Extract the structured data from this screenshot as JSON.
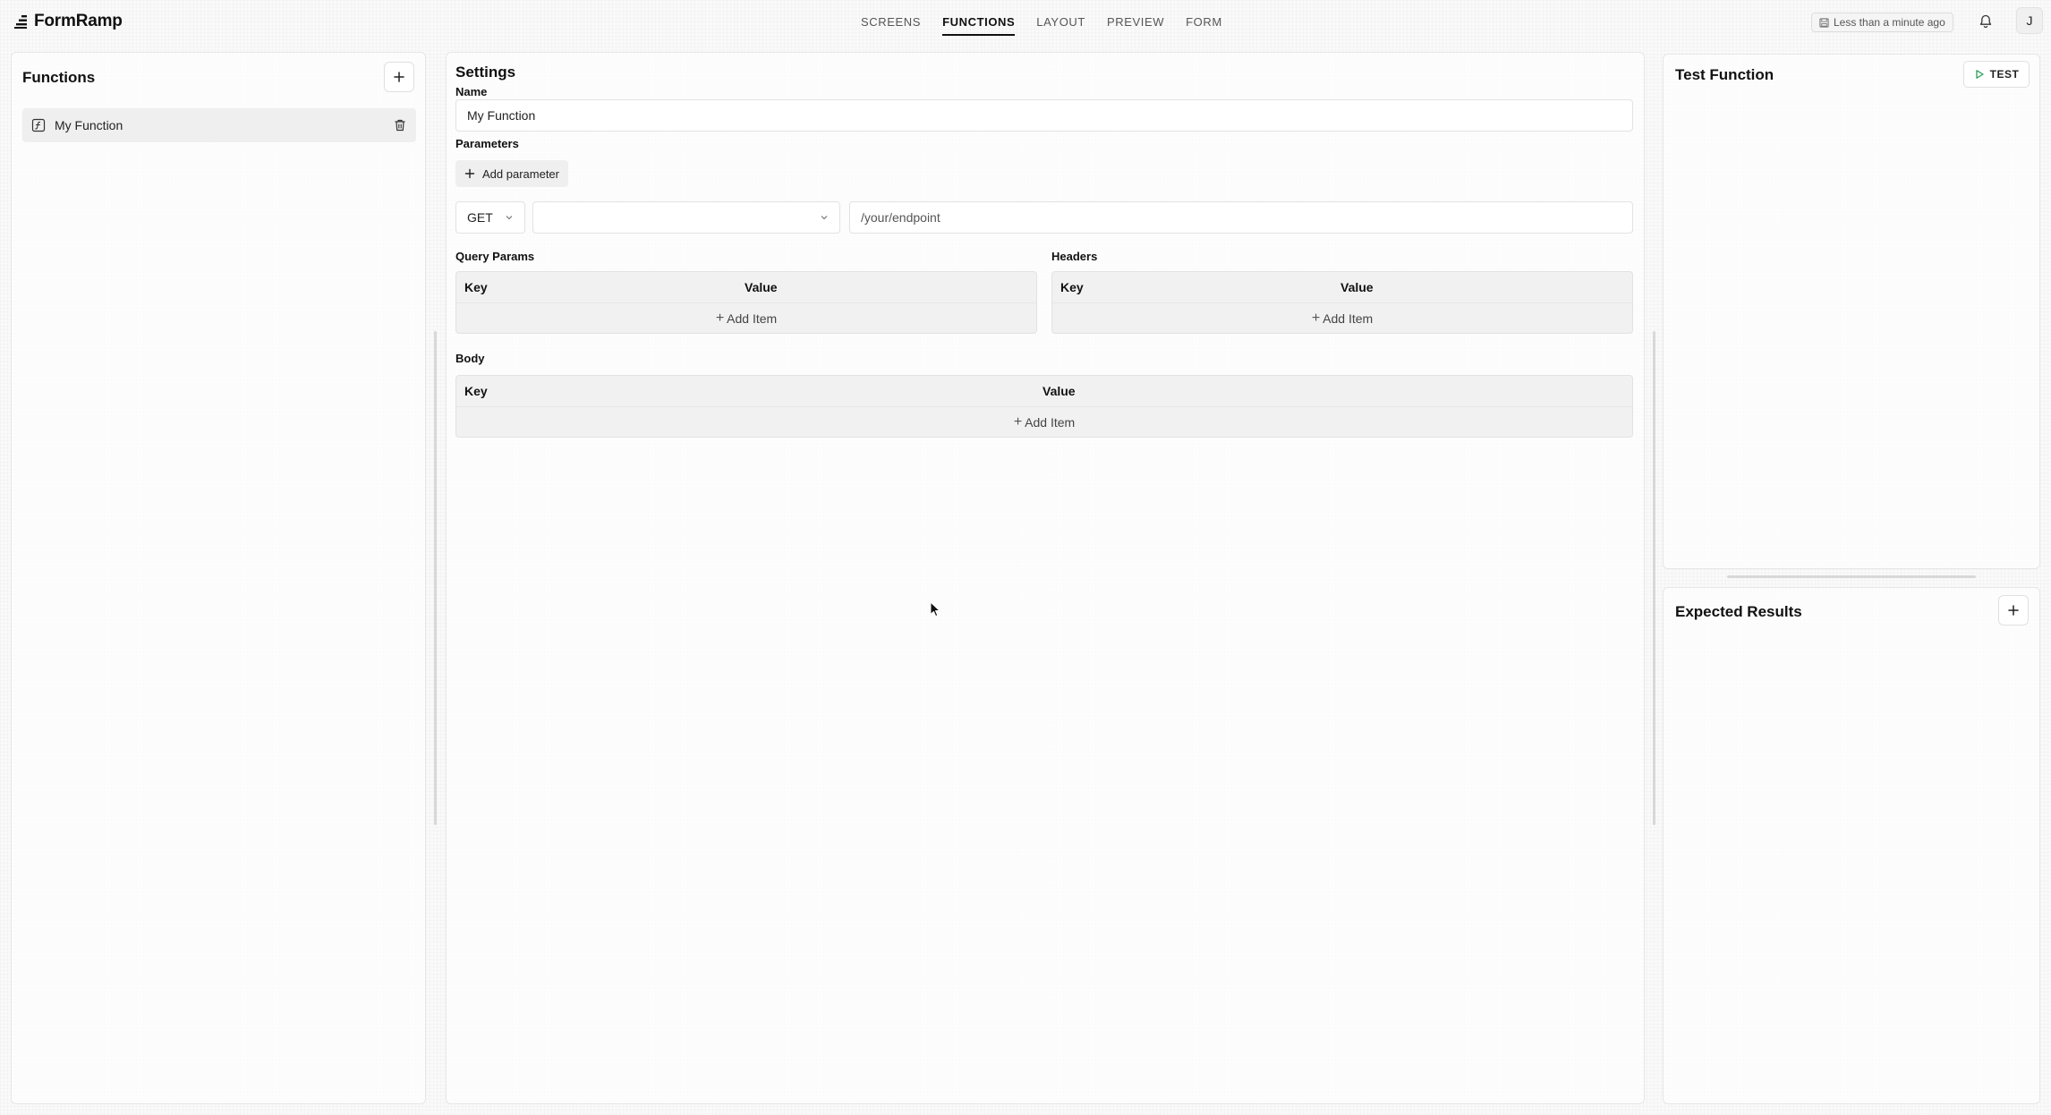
{
  "app": {
    "name": "FormRamp"
  },
  "nav": {
    "tabs": [
      {
        "label": "SCREENS",
        "active": false
      },
      {
        "label": "FUNCTIONS",
        "active": true
      },
      {
        "label": "LAYOUT",
        "active": false
      },
      {
        "label": "PREVIEW",
        "active": false
      },
      {
        "label": "FORM",
        "active": false
      }
    ]
  },
  "header": {
    "save_status": "Less than a minute ago",
    "avatar_initial": "J"
  },
  "functions_panel": {
    "title": "Functions",
    "items": [
      {
        "label": "My Function"
      }
    ]
  },
  "settings": {
    "title": "Settings",
    "name_label": "Name",
    "name_value": "My Function",
    "parameters_label": "Parameters",
    "add_parameter_label": "Add parameter",
    "method": "GET",
    "base_url": "",
    "endpoint_placeholder": "/your/endpoint",
    "query_params": {
      "label": "Query Params",
      "key_header": "Key",
      "value_header": "Value",
      "add_label": "Add Item"
    },
    "headers": {
      "label": "Headers",
      "key_header": "Key",
      "value_header": "Value",
      "add_label": "Add Item"
    },
    "body": {
      "label": "Body",
      "key_header": "Key",
      "value_header": "Value",
      "add_label": "Add Item"
    }
  },
  "test_panel": {
    "title": "Test Function",
    "test_label": "TEST"
  },
  "expected_panel": {
    "title": "Expected Results"
  },
  "colors": {
    "accent": "#111111",
    "test_icon": "#2e9e5b"
  }
}
